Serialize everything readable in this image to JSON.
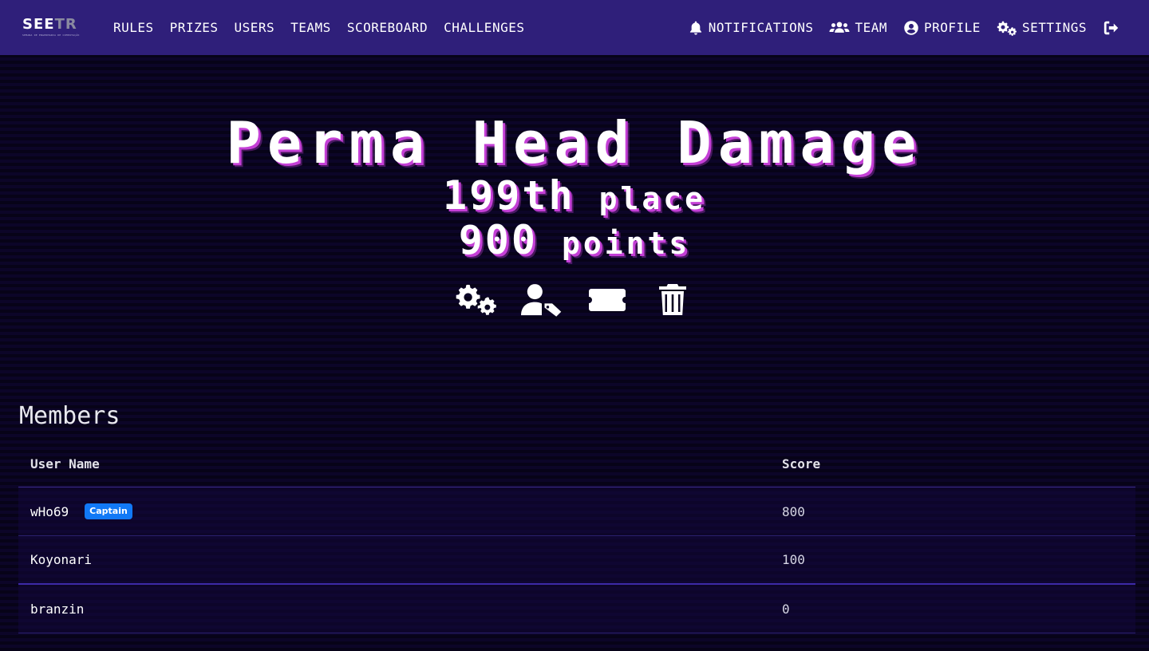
{
  "brand": {
    "name_main": "SEE",
    "name_dim": "TR",
    "tagline": "SEMANA DE ENGENHARIA DE COMPUTAÇÃO"
  },
  "nav": {
    "left": [
      {
        "label": "RULES"
      },
      {
        "label": "PRIZES"
      },
      {
        "label": "USERS"
      },
      {
        "label": "TEAMS"
      },
      {
        "label": "SCOREBOARD"
      },
      {
        "label": "CHALLENGES"
      }
    ],
    "right": [
      {
        "label": "NOTIFICATIONS",
        "icon": "bell-icon"
      },
      {
        "label": "TEAM",
        "icon": "users-icon"
      },
      {
        "label": "PROFILE",
        "icon": "user-circle-icon"
      },
      {
        "label": "SETTINGS",
        "icon": "cogs-icon"
      }
    ],
    "logout_icon": "sign-out-icon"
  },
  "team": {
    "name": "Perma Head Damage",
    "place_number": "199th",
    "place_word": "place",
    "points_number": "900",
    "points_word": "points"
  },
  "actions": [
    {
      "icon": "cogs-icon"
    },
    {
      "icon": "user-tag-icon"
    },
    {
      "icon": "ticket-icon"
    },
    {
      "icon": "trash-icon"
    }
  ],
  "members": {
    "title": "Members",
    "columns": [
      "User Name",
      "Score"
    ],
    "rows": [
      {
        "name": "wHo69",
        "badge": "Captain",
        "score": "800"
      },
      {
        "name": "Koyonari",
        "badge": "",
        "score": "100"
      },
      {
        "name": "branzin",
        "badge": "",
        "score": "0"
      }
    ]
  },
  "colors": {
    "navbar": "#2f1f7a",
    "background": "#0a0420",
    "accent_shadow": "#c43fd6",
    "captain_badge": "#1179f6"
  }
}
